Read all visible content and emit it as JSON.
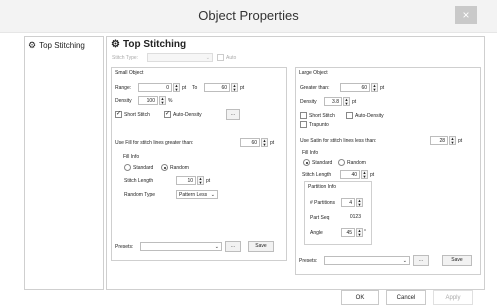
{
  "window": {
    "title": "Object Properties",
    "close_label": "×"
  },
  "tree": {
    "items": [
      {
        "label": "Top Stitching"
      }
    ]
  },
  "panel": {
    "title": "Top Stitching",
    "stitch_type": {
      "label": "Stitch Type:",
      "value": "",
      "auto_label": "Auto"
    }
  },
  "small_object": {
    "group_label": "Small Object",
    "range_label": "Range:",
    "range_from": "0",
    "range_unit1": "pt",
    "to_label": "To",
    "range_to": "60",
    "range_unit2": "pt",
    "density_label": "Density",
    "density_value": "100",
    "density_unit": "%",
    "short_stitch_label": "Short Stitch",
    "short_stitch_checked": true,
    "auto_density_label": "Auto-Density",
    "auto_density_checked": true,
    "more_label": "...",
    "fill_label": "Use Fill for stitch lines greater than:",
    "fill_value": "60",
    "fill_unit": "pt",
    "fill_info": {
      "label": "Fill Info",
      "standard_label": "Standard",
      "standard_selected": false,
      "random_label": "Random",
      "random_selected": true,
      "stitch_length_label": "Stitch Length",
      "stitch_length_value": "10",
      "stitch_length_unit": "pt",
      "random_type_label": "Random Type",
      "random_type_value": "Pattern Less"
    },
    "presets_label": "Presets:",
    "presets_value": "",
    "presets_more": "...",
    "save_label": "Save"
  },
  "large_object": {
    "group_label": "Large Object",
    "greater_label": "Greater than:",
    "greater_value": "60",
    "greater_unit": "pt",
    "density_label": "Density",
    "density_value": "3.8",
    "density_unit": "pt",
    "short_stitch_label": "Short Stitch",
    "short_stitch_checked": false,
    "auto_density_label": "Auto-Density",
    "auto_density_checked": false,
    "trapunto_label": "Trapunto",
    "trapunto_checked": false,
    "satin_label": "Use Satin for stitch lines less than:",
    "satin_value": "28",
    "satin_unit": "pt",
    "fill_info": {
      "label": "Fill Info",
      "standard_label": "Standard",
      "standard_selected": true,
      "random_label": "Random",
      "random_selected": false,
      "stitch_length_label": "Stitch Length",
      "stitch_length_value": "40",
      "stitch_length_unit": "pt"
    },
    "partition_info": {
      "label": "Partition Info",
      "partitions_label": "# Partitions",
      "partitions_value": "4",
      "part_seq_label": "Part Seq",
      "part_seq_value": "0123",
      "angle_label": "Angle",
      "angle_value": "45",
      "angle_unit": "°"
    },
    "presets_label": "Presets:",
    "presets_value": "",
    "presets_more": "...",
    "save_label": "Save"
  },
  "footer": {
    "ok_label": "OK",
    "cancel_label": "Cancel",
    "apply_label": "Apply"
  }
}
